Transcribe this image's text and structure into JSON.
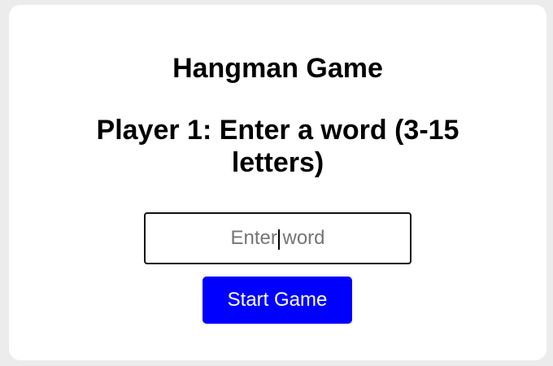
{
  "game": {
    "title": "Hangman Game",
    "prompt": "Player 1: Enter a word (3-15 letters)"
  },
  "word_input": {
    "placeholder": "Enter word",
    "value": ""
  },
  "start_button": {
    "label": "Start Game"
  },
  "colors": {
    "page_background": "#ececec",
    "card_background": "#ffffff",
    "button_background": "#0000ff",
    "button_text": "#ffffff",
    "text": "#000000"
  }
}
